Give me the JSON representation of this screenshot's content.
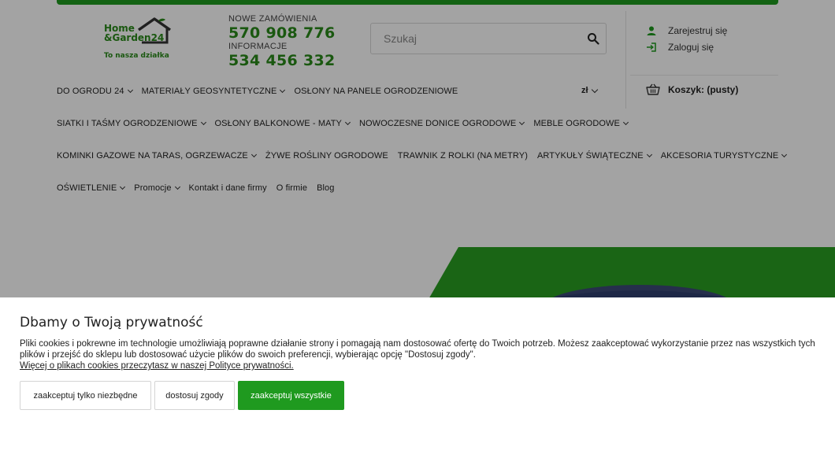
{
  "header": {
    "logo": {
      "line1": "Home",
      "line2": "&Garden24",
      "tagline": "To nasza działka"
    },
    "orders_label": "NOWE ZAMÓWIENIA",
    "orders_phone": "570 908 776",
    "info_label": "INFORMACJE",
    "info_phone": "534 456 332",
    "search_placeholder": "Szukaj",
    "register": "Zarejestruj się",
    "login": "Zaloguj się",
    "currency": "zł",
    "cart": "Koszyk: (pusty)"
  },
  "nav": {
    "row1": [
      {
        "label": "DO OGRODU 24",
        "dropdown": true
      },
      {
        "label": "MATERIAŁY GEOSYNTETYCZNE",
        "dropdown": true
      },
      {
        "label": "OSŁONY NA PANELE OGRODZENIOWE",
        "dropdown": false
      }
    ],
    "row2": [
      {
        "label": "SIATKI I TAŚMY OGRODZENIOWE",
        "dropdown": true
      },
      {
        "label": "OSŁONY BALKONOWE - MATY",
        "dropdown": true
      },
      {
        "label": "NOWOCZESNE DONICE OGRODOWE",
        "dropdown": true
      },
      {
        "label": "MEBLE OGRODOWE",
        "dropdown": true
      }
    ],
    "row3": [
      {
        "label": "KOMINKI GAZOWE NA TARAS, OGRZEWACZE",
        "dropdown": true
      },
      {
        "label": "ŻYWE ROŚLINY OGRODOWE",
        "dropdown": false
      },
      {
        "label": "TRAWNIK Z ROLKI (NA METRY)",
        "dropdown": false
      },
      {
        "label": "ARTYKUŁY ŚWIĄTECZNE",
        "dropdown": true
      },
      {
        "label": "AKCESORIA TURYSTYCZNE",
        "dropdown": true
      }
    ],
    "row4": [
      {
        "label": "OŚWIETLENIE",
        "dropdown": true
      },
      {
        "label": "Promocje",
        "dropdown": true
      },
      {
        "label": "Kontakt i dane firmy",
        "dropdown": false
      },
      {
        "label": "O firmie",
        "dropdown": false
      },
      {
        "label": "Blog",
        "dropdown": false
      }
    ]
  },
  "cookie": {
    "title": "Dbamy o Twoją prywatność",
    "text": "Pliki cookies i pokrewne im technologie umożliwiają poprawne działanie strony i pomagają nam dostosować ofertę do Twoich potrzeb. Możesz zaakceptować wykorzystanie przez nas wszystkich tych plików i przejść do sklepu lub dostosować użycie plików do swoich preferencji, wybierając opcję \"Dostosuj zgody\".",
    "link": "Więcej o plikach cookies przeczytasz w naszej Polityce prywatności.",
    "btn_necessary": "zaakceptuj tylko niezbędne",
    "btn_customize": "dostosuj zgody",
    "btn_accept_all": "zaakceptuj wszystkie"
  },
  "colors": {
    "brand_green": "#1f9a1f",
    "logo_green": "#2a8a1a"
  }
}
